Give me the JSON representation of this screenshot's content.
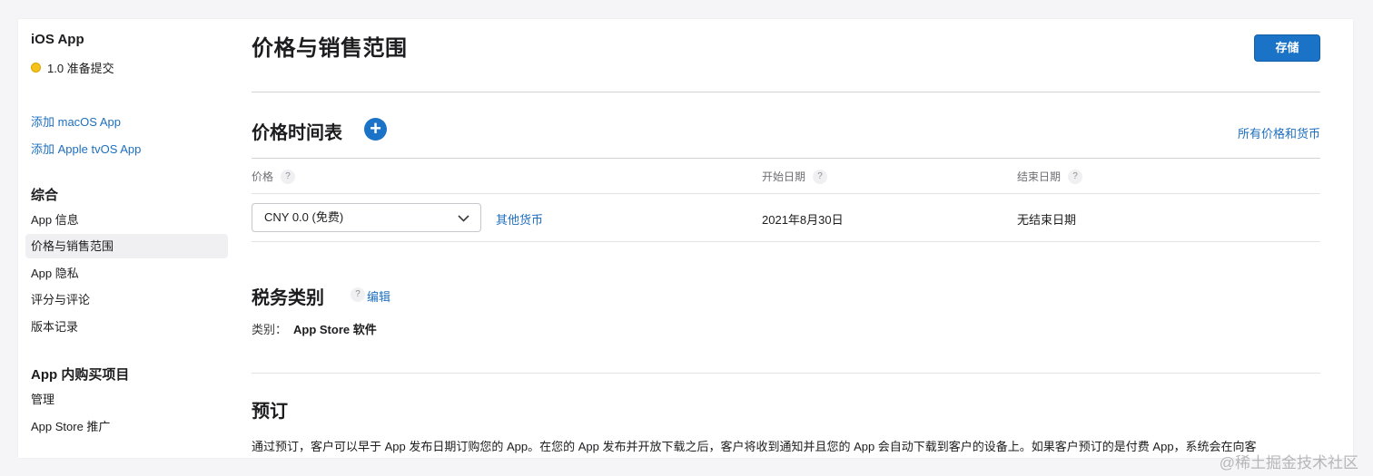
{
  "sidebar": {
    "app_title": "iOS App",
    "status": "1.0 准备提交",
    "add_links": [
      "添加 macOS App",
      "添加 Apple tvOS App"
    ],
    "general_heading": "综合",
    "general_items": [
      "App 信息",
      "价格与销售范围",
      "App 隐私",
      "评分与评论",
      "版本记录"
    ],
    "iap_heading": "App 内购买项目",
    "iap_items": [
      "管理",
      "App Store 推广"
    ]
  },
  "main": {
    "page_title": "价格与销售范围",
    "save_label": "存储",
    "price_schedule": {
      "title": "价格时间表",
      "add_symbol": "+",
      "all_prices_link": "所有价格和货币",
      "columns": [
        "价格",
        "开始日期",
        "结束日期"
      ],
      "help_symbol": "?",
      "price_value": "CNY 0.0 (免费)",
      "other_currency_link": "其他货币",
      "start_date": "2021年8月30日",
      "end_date": "无结束日期"
    },
    "tax": {
      "title": "税务类别",
      "help_symbol": "?",
      "edit_link": "编辑",
      "category_label": "类别：",
      "category_value": "App Store 软件"
    },
    "preorder": {
      "title": "预订",
      "description": "通过预订，客户可以早于 App 发布日期订购您的 App。在您的 App 发布并开放下载之后，客户将收到通知并且您的 App 会自动下载到客户的设备上。如果客户预订的是付费 App，系统会在向客"
    }
  },
  "watermark": "@稀土掘金技术社区",
  "colors": {
    "accent": "#1a73c6",
    "link": "#1e6fbf",
    "status_dot": "#f4c21b"
  }
}
